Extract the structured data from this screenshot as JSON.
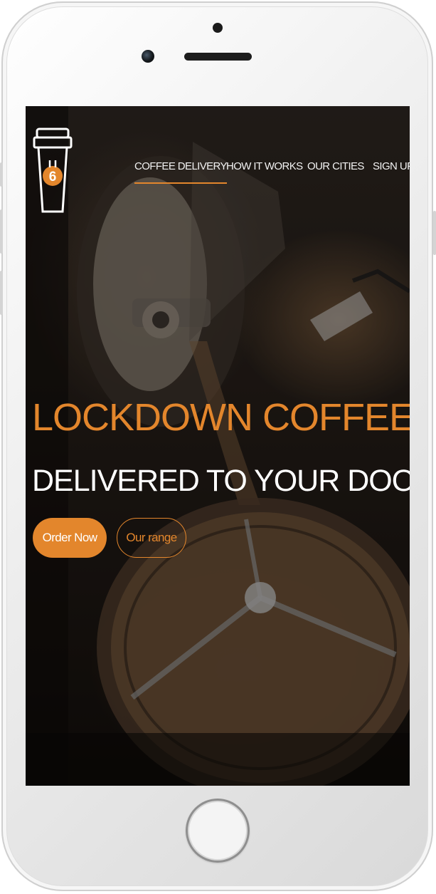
{
  "brand": {
    "logo_mark": "6",
    "accent_color": "#e3862c",
    "logo_icon": "coffee-cup-icon"
  },
  "nav": {
    "items": [
      {
        "label": "COFFEE DELIVERY",
        "active": true
      },
      {
        "label": "HOW IT WORKS",
        "active": false
      },
      {
        "label": "OUR CITIES",
        "active": false
      },
      {
        "label": "SIGN UP",
        "active": false
      }
    ]
  },
  "hero": {
    "title": "LOCKDOWN COFFEE",
    "subtitle": "DELIVERED TO YOUR DOOR!",
    "background": "coffee-roaster-photo"
  },
  "cta": {
    "primary_label": "Order Now",
    "secondary_label": "Our range"
  }
}
